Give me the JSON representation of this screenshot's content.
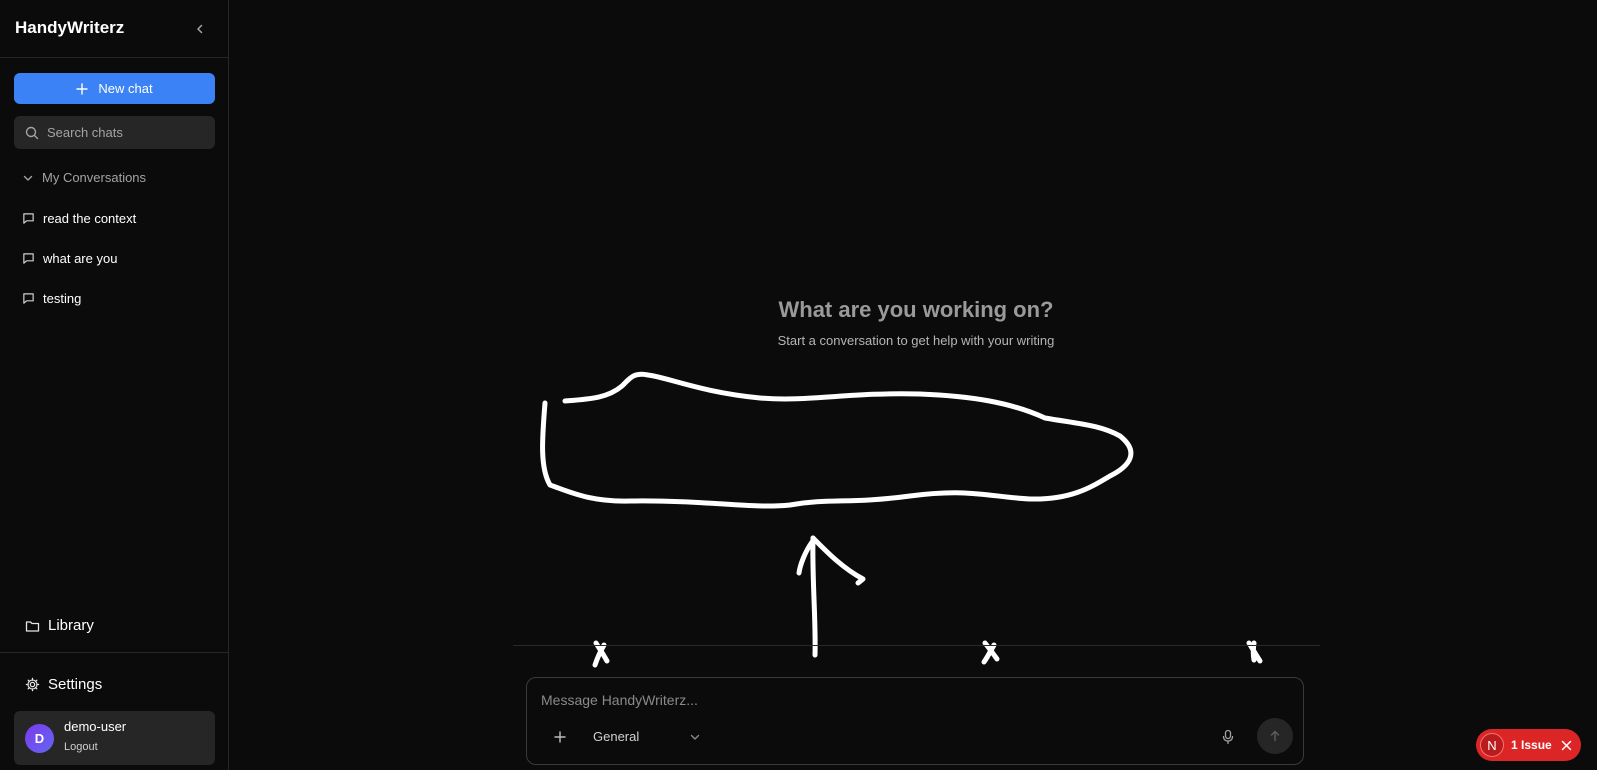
{
  "sidebar": {
    "brand": "HandyWriterz",
    "new_chat_label": "New chat",
    "search_placeholder": "Search chats",
    "section_title": "My Conversations",
    "conversations": [
      {
        "label": "read the context"
      },
      {
        "label": "what are you"
      },
      {
        "label": "testing"
      }
    ],
    "library_label": "Library",
    "settings_label": "Settings",
    "user": {
      "initial": "D",
      "name": "demo-user",
      "logout_label": "Logout"
    }
  },
  "main": {
    "heading": "What are you working on?",
    "subheading": "Start a conversation to get help with your writing"
  },
  "composer": {
    "placeholder": "Message HandyWriterz...",
    "mode_selected": "General"
  },
  "issue_badge": {
    "letter": "N",
    "label": "1 Issue"
  },
  "colors": {
    "background": "#0b0b0b",
    "accent": "#3b82f6",
    "panel": "#262626",
    "error": "#dc2626"
  },
  "icons": [
    "chevron-left-icon",
    "plus-icon",
    "search-icon",
    "chevron-down-icon",
    "message-square-icon",
    "folder-icon",
    "gear-icon",
    "mic-icon",
    "arrow-up-icon",
    "close-icon"
  ]
}
